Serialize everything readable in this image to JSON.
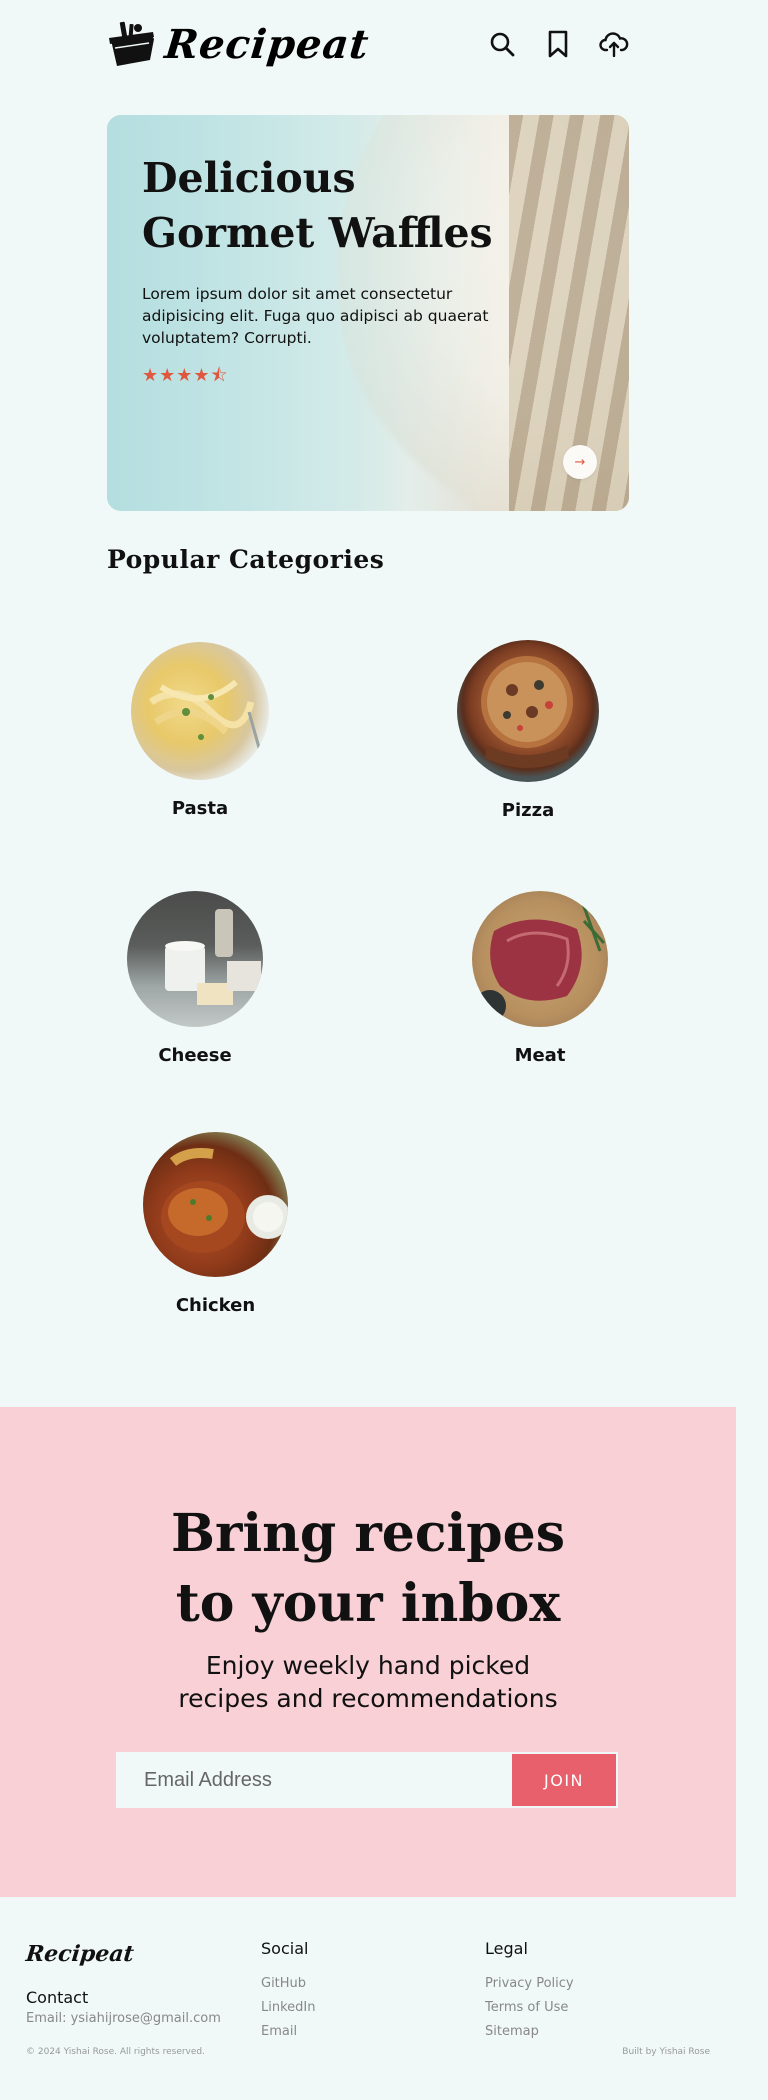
{
  "header": {
    "brand": "Recipeat",
    "icons": [
      "search-icon",
      "bookmark-icon",
      "upload-cloud-icon"
    ]
  },
  "hero": {
    "title": "Delicious Gormet Waffles",
    "description": "Lorem ipsum dolor sit amet consectetur adipisicing elit. Fuga quo adipisci ab quaerat voluptatem? Corrupti.",
    "rating": 4.5,
    "stars": "★★★★⯪",
    "arrow": "→"
  },
  "categories": {
    "title": "Popular Categories",
    "items": [
      {
        "label": "Pasta"
      },
      {
        "label": "Pizza"
      },
      {
        "label": "Cheese"
      },
      {
        "label": "Meat"
      },
      {
        "label": "Chicken"
      }
    ]
  },
  "newsletter": {
    "title_line1": "Bring recipes",
    "title_line2": "to your inbox",
    "subtitle_line1": "Enjoy weekly hand picked",
    "subtitle_line2": "recipes and recommendations",
    "email_placeholder": "Email Address",
    "join_label": "JOIN"
  },
  "footer": {
    "brand": "Recipeat",
    "contact_heading": "Contact",
    "contact_email": "Email: ysiahijrose@gmail.com",
    "social_heading": "Social",
    "social_links": [
      "GitHub",
      "LinkedIn",
      "Email"
    ],
    "legal_heading": "Legal",
    "legal_links": [
      "Privacy Policy",
      "Terms of Use",
      "Sitemap"
    ],
    "copyright": "© 2024 Yishai Rose. All rights reserved.",
    "built_by": "Built by Yishai Rose"
  },
  "colors": {
    "background": "#f0f9f7",
    "accent": "#e8606b",
    "star": "#e0573f",
    "newsletter_bg": "#f8d0d6"
  }
}
